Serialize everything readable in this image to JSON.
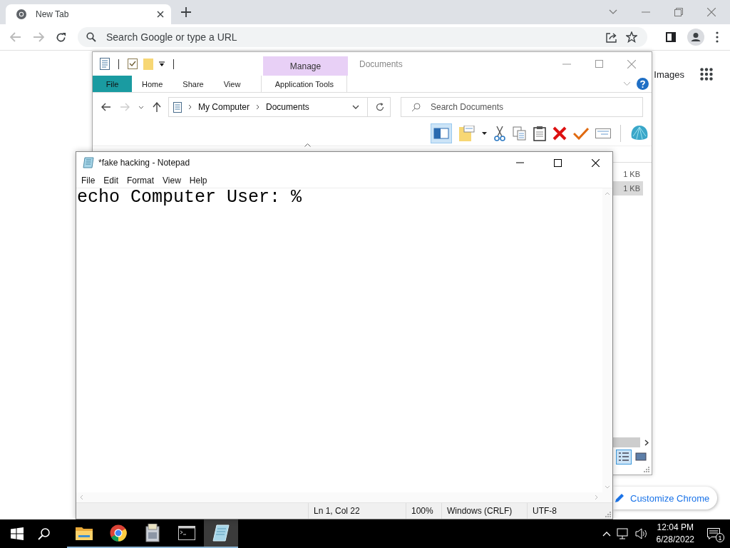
{
  "browser": {
    "tab": {
      "title": "New Tab"
    },
    "omnibox": {
      "placeholder": "Search Google or type a URL"
    },
    "page": {
      "link": "Images",
      "customize_button": "Customize Chrome"
    }
  },
  "explorer": {
    "title": "Documents",
    "contextual_group": "Manage",
    "ribbon_tabs": [
      {
        "label": "File",
        "kind": "file"
      },
      {
        "label": "Home",
        "kind": "tab"
      },
      {
        "label": "Share",
        "kind": "tab"
      },
      {
        "label": "View",
        "kind": "tab"
      },
      {
        "label": "Application Tools",
        "kind": "contextual"
      }
    ],
    "breadcrumbs": [
      "My Computer",
      "Documents"
    ],
    "search": {
      "placeholder": "Search Documents"
    },
    "preview_pane_on": true,
    "rows": [
      {
        "size": "1 KB",
        "selected": false
      },
      {
        "size": "1 KB",
        "selected": true
      }
    ],
    "views": [
      {
        "kind": "details",
        "selected": true
      },
      {
        "kind": "large",
        "selected": false
      }
    ]
  },
  "notepad": {
    "title": "*fake hacking - Notepad",
    "menu": [
      "File",
      "Edit",
      "Format",
      "View",
      "Help"
    ],
    "content": "echo Computer User: %",
    "status": [
      "Ln 1, Col 22",
      "100%",
      "Windows (CRLF)",
      "UTF-8"
    ]
  },
  "taskbar": {
    "apps": [
      {
        "kind": "folder",
        "active": false
      },
      {
        "kind": "chrome",
        "active": false
      },
      {
        "kind": "archive",
        "active": false
      },
      {
        "kind": "terminal",
        "active": false
      },
      {
        "kind": "notepad",
        "active": true
      }
    ],
    "time": "12:04 PM",
    "date": "6/28/2022",
    "notifications": "1"
  }
}
